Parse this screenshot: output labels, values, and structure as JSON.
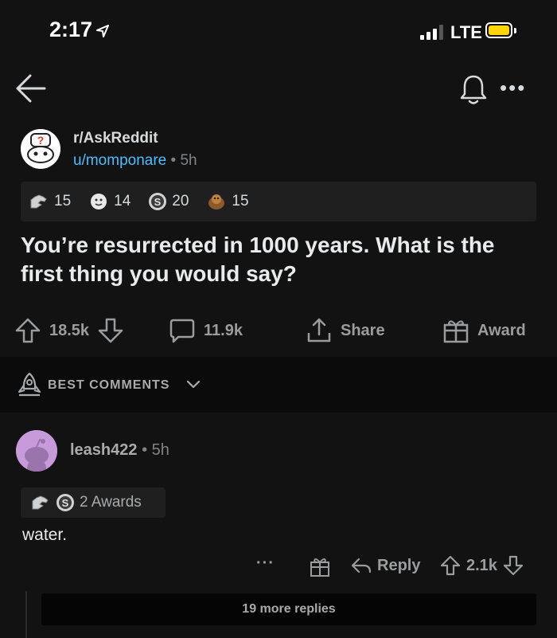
{
  "status_bar": {
    "time": "2:17",
    "network": "LTE"
  },
  "post": {
    "subreddit": "r/AskReddit",
    "username": "u/momponare",
    "separator": "•",
    "age": "5h",
    "awards": [
      {
        "icon": "silver-hand-award-icon",
        "count": "15"
      },
      {
        "icon": "wholesome-award-icon",
        "count": "14"
      },
      {
        "icon": "s-coin-award-icon",
        "count": "20"
      },
      {
        "icon": "helpful-award-icon",
        "count": "15"
      }
    ],
    "title": "You’re resurrected in 1000 years. What is the first thing you would say?",
    "votes": "18.5k",
    "comments": "11.9k",
    "share_label": "Share",
    "award_label": "Award"
  },
  "sort": {
    "label": "BEST COMMENTS"
  },
  "comment": {
    "username": "leash422",
    "separator": "•",
    "age": "5h",
    "awards_label": "2 Awards",
    "body": "water.",
    "more": "···",
    "reply_label": "Reply",
    "votes": "2.1k",
    "more_replies": "19 more replies"
  },
  "colors": {
    "background": "#121212",
    "link": "#4fbcff",
    "battery": "#ffd60a",
    "comment_avatar": "#c79ad9"
  }
}
